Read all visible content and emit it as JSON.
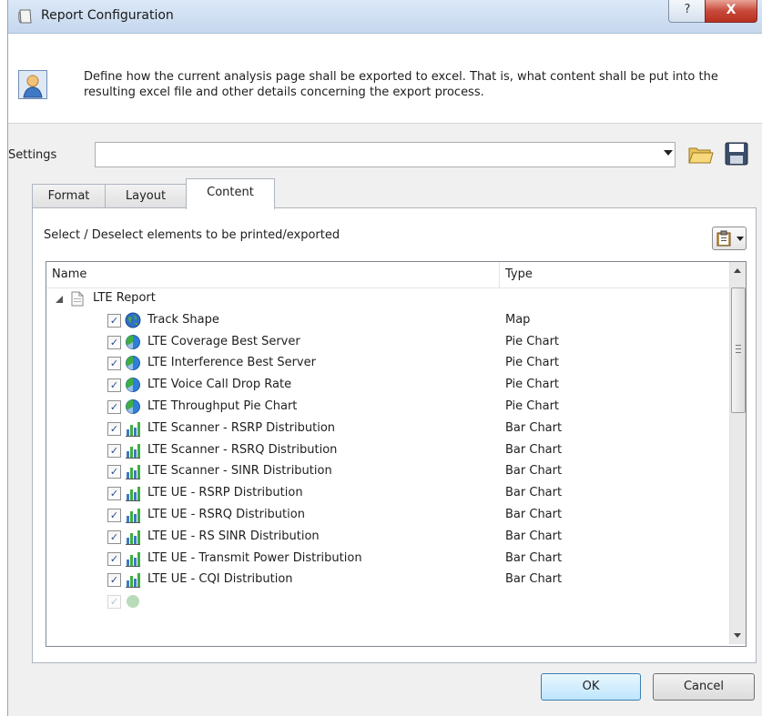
{
  "window": {
    "title": "Report Configuration",
    "help_label": "?",
    "close_label": "X"
  },
  "header": {
    "description": "Define how the current analysis page shall be exported to excel. That is, what content shall be put into the resulting excel file and other details concerning the export process."
  },
  "settings": {
    "label": "Settings",
    "value": ""
  },
  "tabs": [
    {
      "label": "Format"
    },
    {
      "label": "Layout"
    },
    {
      "label": "Content"
    }
  ],
  "content": {
    "instruction": "Select / Deselect elements to be printed/exported",
    "columns": {
      "name": "Name",
      "type": "Type"
    },
    "root": {
      "label": "LTE Report"
    },
    "items": [
      {
        "label": "Track Shape",
        "type": "Map",
        "icon": "globe-icon",
        "checked": true
      },
      {
        "label": "LTE Coverage Best Server",
        "type": "Pie Chart",
        "icon": "pie-chart-icon",
        "checked": true
      },
      {
        "label": "LTE Interference Best Server",
        "type": "Pie Chart",
        "icon": "pie-chart-icon",
        "checked": true
      },
      {
        "label": "LTE Voice Call Drop Rate",
        "type": "Pie Chart",
        "icon": "pie-chart-icon",
        "checked": true
      },
      {
        "label": "LTE Throughput Pie Chart",
        "type": "Pie Chart",
        "icon": "pie-chart-icon",
        "checked": true
      },
      {
        "label": "LTE Scanner - RSRP Distribution",
        "type": "Bar Chart",
        "icon": "bar-chart-icon",
        "checked": true
      },
      {
        "label": "LTE Scanner - RSRQ Distribution",
        "type": "Bar Chart",
        "icon": "bar-chart-icon",
        "checked": true
      },
      {
        "label": "LTE Scanner - SINR Distribution",
        "type": "Bar Chart",
        "icon": "bar-chart-icon",
        "checked": true
      },
      {
        "label": "LTE UE - RSRP Distribution",
        "type": "Bar Chart",
        "icon": "bar-chart-icon",
        "checked": true
      },
      {
        "label": "LTE UE - RSRQ Distribution",
        "type": "Bar Chart",
        "icon": "bar-chart-icon",
        "checked": true
      },
      {
        "label": "LTE UE - RS SINR Distribution",
        "type": "Bar Chart",
        "icon": "bar-chart-icon",
        "checked": true
      },
      {
        "label": "LTE UE - Transmit Power Distribution",
        "type": "Bar Chart",
        "icon": "bar-chart-icon",
        "checked": true
      },
      {
        "label": "LTE UE - CQI Distribution",
        "type": "Bar Chart",
        "icon": "bar-chart-icon",
        "checked": true
      }
    ]
  },
  "buttons": {
    "ok": "OK",
    "cancel": "Cancel"
  }
}
